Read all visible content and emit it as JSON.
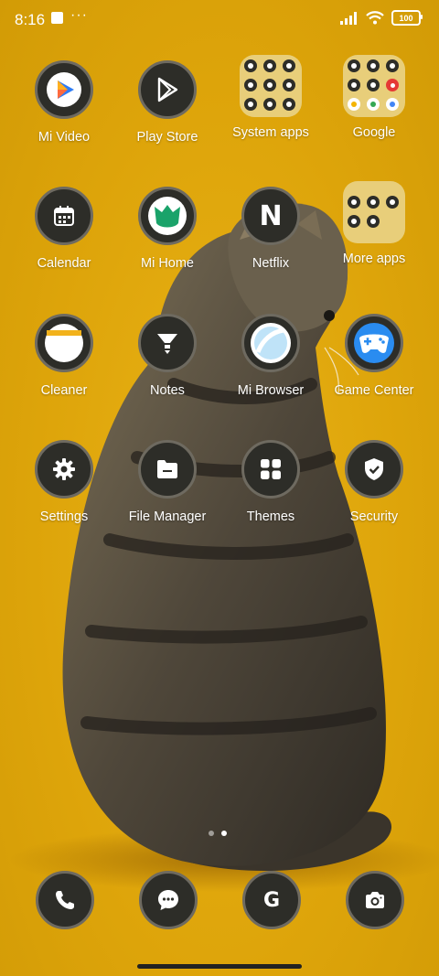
{
  "status_bar": {
    "time": "8:16",
    "more": "···",
    "battery": "100"
  },
  "apps": [
    {
      "label": "Mi Video",
      "icon": "mi-video-icon"
    },
    {
      "label": "Play Store",
      "icon": "play-store-icon"
    },
    {
      "label": "System apps",
      "icon": "system-apps-folder"
    },
    {
      "label": "Google",
      "icon": "google-folder"
    },
    {
      "label": "Calendar",
      "icon": "calendar-icon"
    },
    {
      "label": "Mi Home",
      "icon": "mi-home-icon"
    },
    {
      "label": "Netflix",
      "icon": "netflix-icon",
      "glyph": "N"
    },
    {
      "label": "More apps",
      "icon": "more-apps-folder"
    },
    {
      "label": "Cleaner",
      "icon": "cleaner-icon"
    },
    {
      "label": "Notes",
      "icon": "notes-icon"
    },
    {
      "label": "Mi Browser",
      "icon": "browser-icon"
    },
    {
      "label": "Game Center",
      "icon": "game-center-icon"
    },
    {
      "label": "Settings",
      "icon": "gear-icon"
    },
    {
      "label": "File Manager",
      "icon": "file-manager-icon"
    },
    {
      "label": "Themes",
      "icon": "themes-icon"
    },
    {
      "label": "Security",
      "icon": "shield-icon"
    }
  ],
  "dock": [
    {
      "icon": "phone-icon"
    },
    {
      "icon": "messages-icon"
    },
    {
      "icon": "google-search-icon",
      "glyph": "G"
    },
    {
      "icon": "camera-icon"
    }
  ],
  "page_indicator": {
    "pages": 2,
    "active": 2
  },
  "colors": {
    "wallpaper": "#E0A90B",
    "icon_bg": "#2d2d28",
    "icon_ring": "#6e6a60",
    "folder_bg": "#E8CE7A"
  }
}
